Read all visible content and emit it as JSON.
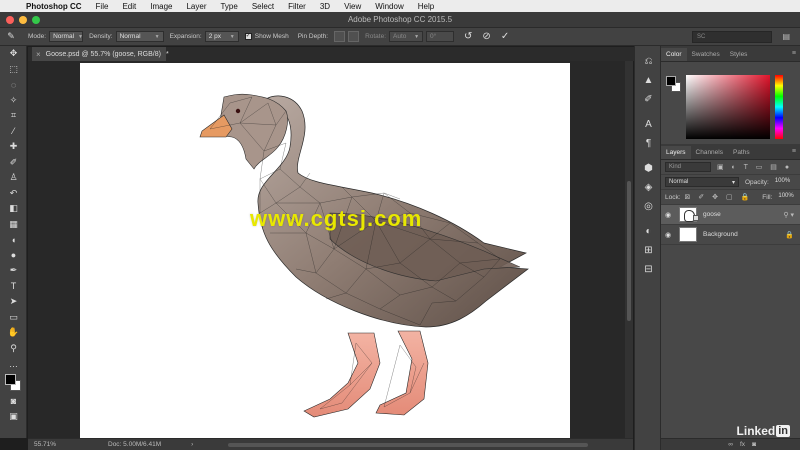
{
  "menubar": {
    "app_name": "Photoshop CC",
    "items": [
      "File",
      "Edit",
      "Image",
      "Layer",
      "Type",
      "Select",
      "Filter",
      "3D",
      "View",
      "Window",
      "Help"
    ]
  },
  "window": {
    "title": "Adobe Photoshop CC 2015.5"
  },
  "options_bar": {
    "mode_label": "Mode:",
    "mode_value": "Normal",
    "density_label": "Density:",
    "density_value": "Normal",
    "expansion_label": "Expansion:",
    "expansion_value": "2 px",
    "show_mesh_label": "Show Mesh",
    "pin_depth_label": "Pin Depth:",
    "rotate_label": "Rotate:",
    "rotate_value": "Auto",
    "rotate_degrees": "0°",
    "search_placeholder": "SC"
  },
  "document": {
    "tab_title": "Goose.psd @ 55.7% (goose, RGB/8)",
    "tab_modified": "*"
  },
  "statusbar": {
    "zoom": "55.71%",
    "doc_info": "Doc: 5.00M/6.41M",
    "arrow": "›"
  },
  "color_panel": {
    "tabs": [
      "Color",
      "Swatches",
      "Styles"
    ],
    "active_tab": "Color"
  },
  "layers_panel": {
    "tabs": [
      "Layers",
      "Channels",
      "Paths"
    ],
    "kind_placeholder": "Kind",
    "blend_mode": "Normal",
    "opacity_label": "Opacity:",
    "opacity_value": "100%",
    "lock_label": "Lock:",
    "fill_label": "Fill:",
    "fill_value": "100%",
    "layers": [
      {
        "name": "goose",
        "selected": true
      },
      {
        "name": "Background",
        "selected": false
      }
    ]
  },
  "watermarks": {
    "linkedin_text": "Linked",
    "linkedin_in": "in",
    "site": "www.cgtsj.com"
  },
  "colors": {
    "menubar_bg": "#ececec",
    "panel_bg": "#424242",
    "canvas_bg": "#282828",
    "document_bg": "#ffffff",
    "watermark_yellow": "#e8e800"
  },
  "icons": {
    "apple": "apple-icon",
    "tool": "puppet-pin-tool-icon",
    "cancel": "cancel-icon",
    "commit": "checkmark-icon",
    "undo_pin": "remove-pins-icon"
  }
}
